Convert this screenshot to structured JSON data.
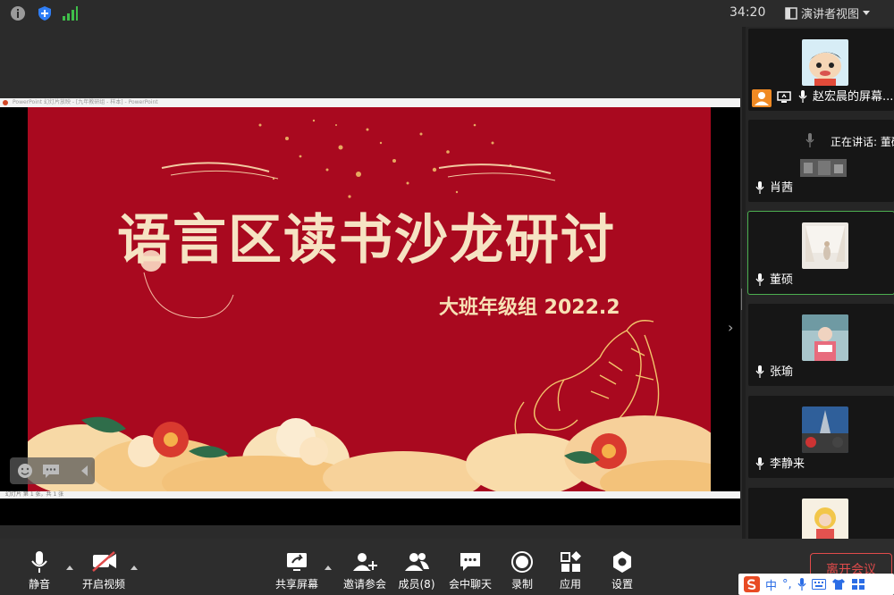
{
  "topbar": {
    "time": "34:20",
    "view_label": "演讲者视图",
    "icons": [
      "info-icon",
      "shield-icon",
      "signal-icon",
      "layout-icon",
      "chevron-down-icon"
    ]
  },
  "shared_screen": {
    "window_title": "PowerPoint 幻灯片放映 - [九年教研组 - 样本] - PowerPoint",
    "status_text": "幻灯片 第 1 张，共 1 张",
    "slide": {
      "title": "语言区读书沙龙研讨",
      "subtitle": "大班年级组  2022.2"
    }
  },
  "sidebar": {
    "participants": [
      {
        "name": "赵宏晨的屏幕...",
        "avatar": "cartoon-avatar"
      },
      {
        "name": "肖茜",
        "speaking_label": "正在讲话: 董硕"
      },
      {
        "name": "董硕",
        "active": true
      },
      {
        "name": "张瑜"
      },
      {
        "name": "李静来"
      },
      {
        "name": ""
      }
    ]
  },
  "toolbar": {
    "mute_label": "静音",
    "video_label": "开启视频",
    "share_label": "共享屏幕",
    "invite_label": "邀请参会",
    "members_label": "成员(8)",
    "chat_label": "会中聊天",
    "record_label": "录制",
    "apps_label": "应用",
    "settings_label": "设置",
    "leave_label": "离开会议"
  },
  "ime": {
    "mode": "中"
  },
  "colors": {
    "slide_red": "#a9091f",
    "slide_gold": "#f6e3c3",
    "leave_red": "#e04b4b",
    "active_green": "#4caf50"
  }
}
